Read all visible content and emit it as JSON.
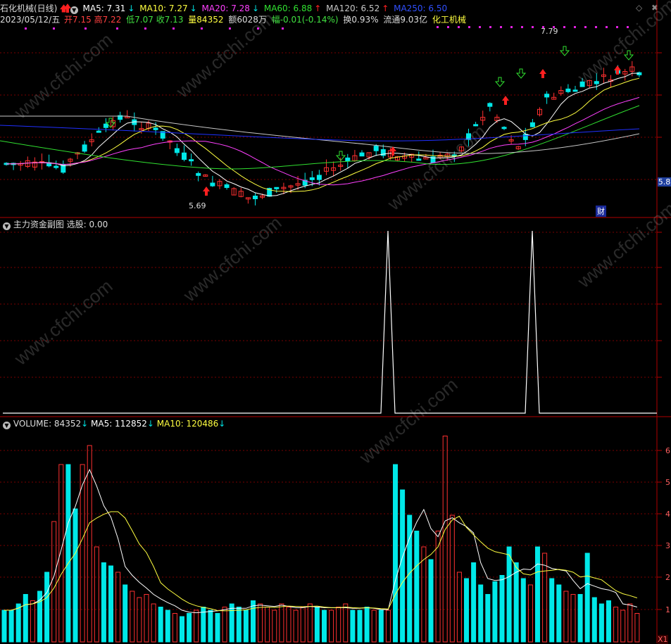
{
  "header": {
    "stock_name": "石化机械(日线)",
    "ma5": "MA5: 7.31",
    "ma10": "MA10: 7.27",
    "ma20": "MA20: 7.28",
    "ma60": "MA60: 6.88",
    "ma120": "MA120: 6.52",
    "ma250": "MA250: 6.50",
    "date": "2023/05/12/五",
    "open": "开7.15",
    "high": "高7.22",
    "low": "低7.07",
    "close": "收7.13",
    "volume": "量84352",
    "amount": "额6028万",
    "change": "幅-0.01(-0.14%)",
    "turnover": "换0.93%",
    "float_cap": "流通9.03亿",
    "sector": "化工机械"
  },
  "price_pane": {
    "high_marker": "7.79",
    "low_marker": "5.69",
    "price_tag": "5.8",
    "finance_badge": "财"
  },
  "indicator_pane": {
    "title": "主力资金副图",
    "value_label": "选股: 0.00"
  },
  "volume_pane": {
    "volume_label": "VOLUME: 84352",
    "ma5_label": "MA5: 112852",
    "ma10_label": "MA10: 120486",
    "axis_ticks": [
      "6",
      "5",
      "4",
      "3",
      "2",
      "1"
    ],
    "unit": "X1"
  },
  "watermark": "www.cfchi.com",
  "colors": {
    "up": "#ff3030",
    "down": "#00e8e8",
    "ma5": "#ffffff",
    "ma10": "#ffff40",
    "ma20": "#ff40ff",
    "ma60": "#30e030",
    "ma120": "#c8c8c8",
    "ma250": "#2030ff",
    "grid": "#7a0000"
  }
}
